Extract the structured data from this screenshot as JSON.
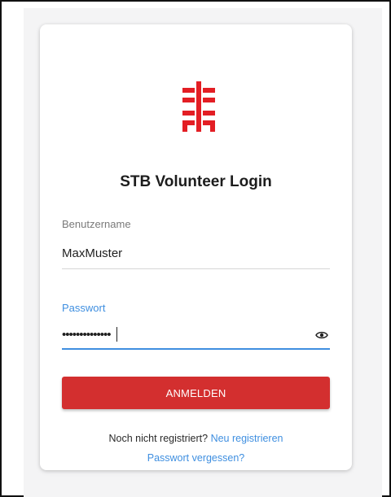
{
  "brand": {
    "accent_color": "#e31e24",
    "logo_icon": "stb-logo-icon"
  },
  "login": {
    "title": "STB Volunteer Login",
    "username_label": "Benutzername",
    "username_value": "MaxMuster",
    "password_label": "Passwort",
    "password_masked": "••••••••••••••",
    "password_toggle_icon": "eye-icon",
    "submit_label": "ANMELDEN"
  },
  "footer": {
    "not_registered_text": "Noch nicht registriert?",
    "register_link": "Neu registrieren",
    "forgot_password_link": "Passwort vergessen?"
  },
  "colors": {
    "button": "#d32f2f",
    "link": "#3f8fe0",
    "focus_underline": "#3f8fe0"
  }
}
